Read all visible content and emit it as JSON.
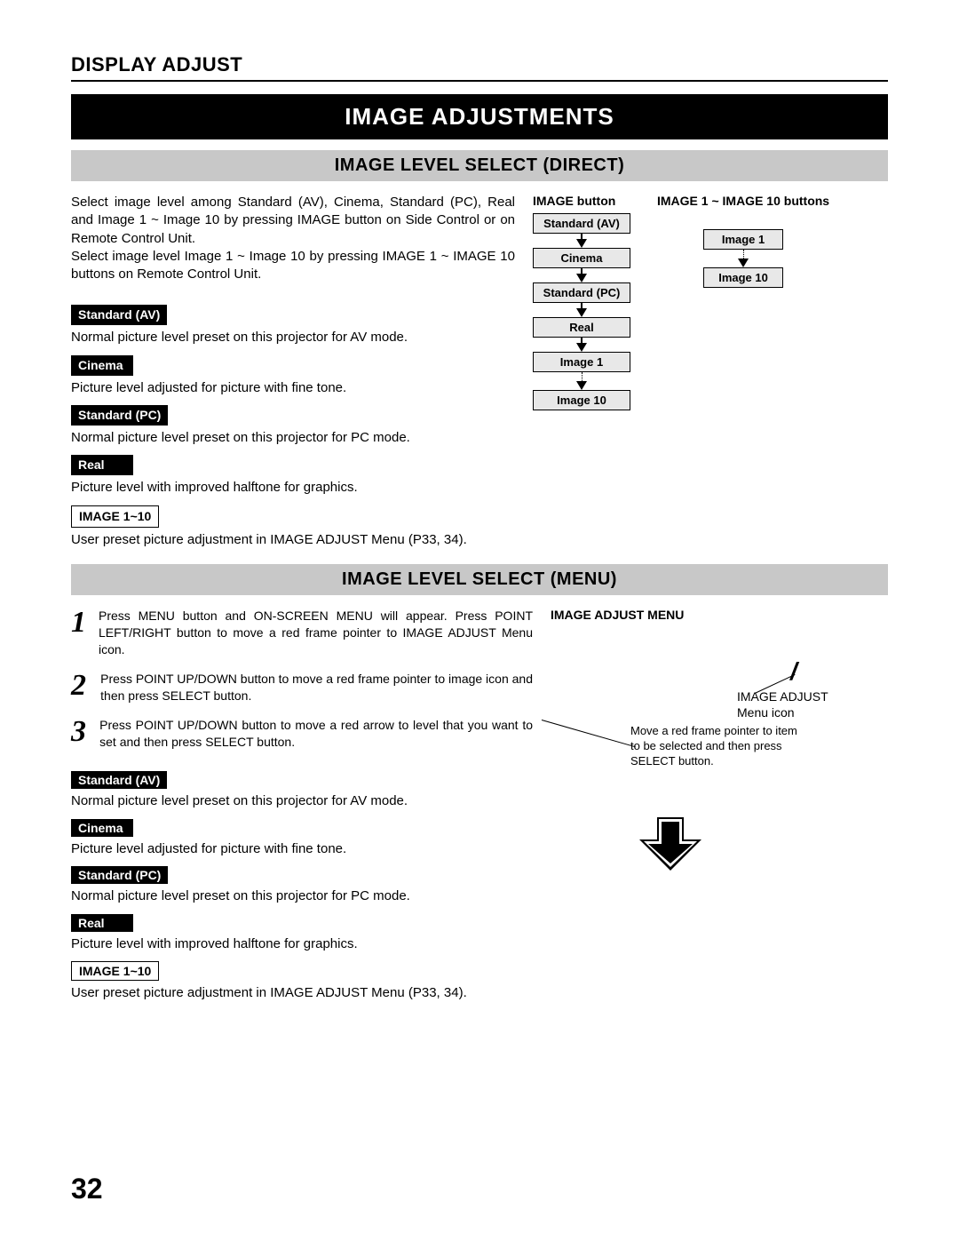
{
  "header": {
    "section": "DISPLAY ADJUST",
    "banner": "IMAGE ADJUSTMENTS"
  },
  "direct": {
    "title": "IMAGE LEVEL SELECT (DIRECT)",
    "intro": "Select image level among Standard (AV), Cinema, Standard (PC), Real and Image 1 ~ Image 10 by pressing IMAGE button on Side Control or on Remote Control Unit.\nSelect image level Image 1 ~ Image 10 by pressing IMAGE 1 ~ IMAGE 10 buttons on Remote Control Unit.",
    "items": [
      {
        "label": "Standard (AV)",
        "style": "black",
        "desc": "Normal picture level preset on this projector for AV mode."
      },
      {
        "label": "Cinema",
        "style": "black",
        "desc": "Picture level adjusted for picture with fine tone."
      },
      {
        "label": "Standard (PC)",
        "style": "black",
        "desc": "Normal picture level preset on this projector for PC mode."
      },
      {
        "label": "Real",
        "style": "black",
        "desc": "Picture level with improved halftone for graphics."
      },
      {
        "label": "IMAGE 1~10",
        "style": "outline",
        "desc": "User preset picture adjustment in IMAGE ADJUST Menu (P33, 34)."
      }
    ],
    "diagram": {
      "col1_title": "IMAGE button",
      "col1_boxes": [
        "Standard (AV)",
        "Cinema",
        "Standard (PC)",
        "Real",
        "Image 1",
        "Image 10"
      ],
      "col2_title": "IMAGE 1 ~ IMAGE 10 buttons",
      "col2_boxes": [
        "Image 1",
        "Image 10"
      ]
    }
  },
  "menu": {
    "title": "IMAGE LEVEL SELECT (MENU)",
    "steps": [
      {
        "n": "1",
        "text": "Press MENU button and ON-SCREEN MENU will appear.  Press POINT LEFT/RIGHT button to move a red frame pointer to IMAGE ADJUST Menu icon."
      },
      {
        "n": "2",
        "text": "Press POINT UP/DOWN button to move a red frame pointer to image icon and then press SELECT button."
      },
      {
        "n": "3",
        "text": "Press POINT UP/DOWN button to move a red arrow to level that you want to set and then press SELECT button."
      }
    ],
    "right_title": "IMAGE ADJUST MENU",
    "icon_label": "IMAGE ADJUST Menu icon",
    "callout": "Move a red frame pointer to item to be selected and then press SELECT button.",
    "items": [
      {
        "label": "Standard (AV)",
        "style": "black",
        "desc": "Normal picture level preset on this projector for AV mode."
      },
      {
        "label": "Cinema",
        "style": "black",
        "desc": "Picture level adjusted for picture with fine tone."
      },
      {
        "label": "Standard (PC)",
        "style": "black",
        "desc": "Normal picture level preset on this projector for PC mode."
      },
      {
        "label": "Real",
        "style": "black",
        "desc": "Picture level with improved halftone for graphics."
      },
      {
        "label": "IMAGE 1~10",
        "style": "outline",
        "desc": "User preset picture adjustment in IMAGE ADJUST Menu (P33, 34)."
      }
    ]
  },
  "page_number": "32"
}
